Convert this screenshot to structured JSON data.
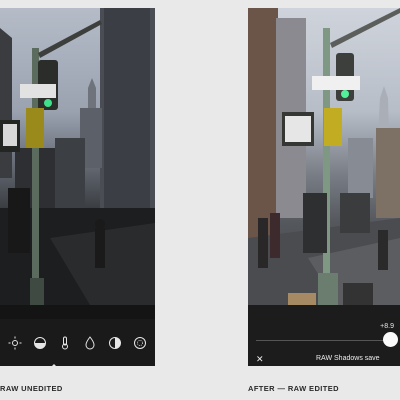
{
  "left_panel": {
    "caption": "RAW UNEDITED",
    "toolbar": {
      "tools": [
        {
          "name": "brightness-icon"
        },
        {
          "name": "contrast-icon"
        },
        {
          "name": "temperature-icon"
        },
        {
          "name": "saturation-drop-icon"
        },
        {
          "name": "shadows-halfcircle-icon"
        },
        {
          "name": "vignette-icon"
        }
      ]
    }
  },
  "right_panel": {
    "caption": "AFTER — RAW EDITED",
    "slider": {
      "value_label": "+8.9",
      "value": 8.9
    },
    "close_label": "✕",
    "mode_label": "RAW Shadows save"
  },
  "colors": {
    "page_bg": "#e9e9e9",
    "phone_bg": "#141414",
    "toolbar_bg": "#1a1a1a",
    "handle": "#fafafa"
  }
}
